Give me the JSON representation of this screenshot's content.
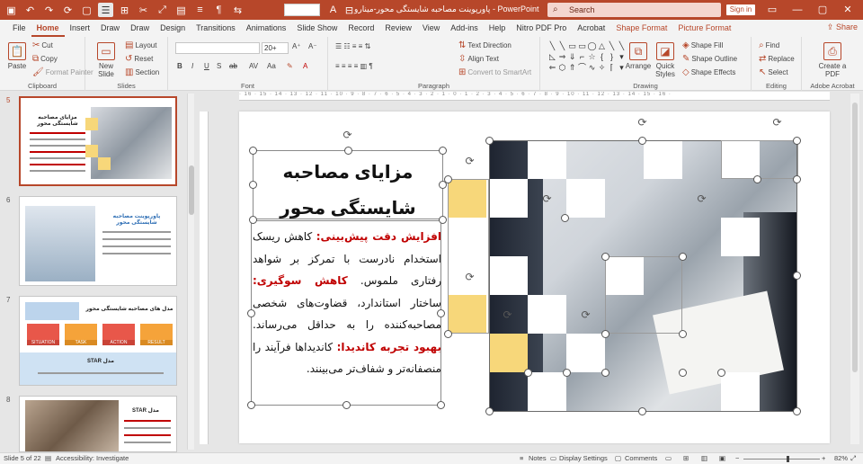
{
  "window": {
    "title": "پاورپوینت مصاحبه شایستگی محور-مینارو  -  PowerPoint",
    "search_placeholder": "Search",
    "sign_in": "Sign in",
    "share": "Share"
  },
  "tabs": [
    "File",
    "Home",
    "Insert",
    "Draw",
    "Draw",
    "Design",
    "Transitions",
    "Animations",
    "Slide Show",
    "Record",
    "Review",
    "View",
    "Add-ins",
    "Help",
    "Nitro PDF Pro",
    "Acrobat",
    "Shape Format",
    "Picture Format"
  ],
  "ribbon": {
    "clipboard": {
      "label": "Clipboard",
      "paste": "Paste",
      "cut": "Cut",
      "copy": "Copy",
      "format_painter": "Format Painter"
    },
    "slides": {
      "label": "Slides",
      "new_slide": "New Slide",
      "layout": "Layout",
      "reset": "Reset",
      "section": "Section"
    },
    "font": {
      "label": "Font",
      "size": "20+"
    },
    "paragraph": {
      "label": "Paragraph",
      "text_direction": "Text Direction",
      "align_text": "Align Text",
      "convert_smartart": "Convert to SmartArt"
    },
    "drawing": {
      "label": "Drawing",
      "arrange": "Arrange",
      "quick_styles": "Quick Styles",
      "shape_fill": "Shape Fill",
      "shape_outline": "Shape Outline",
      "shape_effects": "Shape Effects"
    },
    "editing": {
      "label": "Editing",
      "find": "Find",
      "replace": "Replace",
      "select": "Select"
    },
    "adobe": {
      "label": "Adobe Acrobat",
      "create_pdf": "Create a PDF"
    }
  },
  "thumbnails": [
    {
      "num": "5",
      "title": "مزایای مصاحبه شایستگی محور"
    },
    {
      "num": "6",
      "title": "پاورپوینت مصاحبه شایستگی محور"
    },
    {
      "num": "7",
      "title": "مدل های مصاحبه شایستگی محور",
      "labels": [
        "SITUATION",
        "TASK",
        "ACTION",
        "RESULT"
      ],
      "model": "مدل STAR"
    },
    {
      "num": "8",
      "title": "مدل STAR"
    }
  ],
  "slide": {
    "title": "مزایای مصاحبه شایستگی محور",
    "points": [
      {
        "head": "افزایش دقت پیش‌بینی:",
        "text": " کاهش ریسک استخدام نادرست با تمرکز بر شواهد رفتاری ملموس."
      },
      {
        "head": "کاهش سوگیری:",
        "text": " ساختار استاندارد، قضاوت‌های شخصی مصاحبه‌کننده را به حداقل می‌رساند."
      },
      {
        "head": "بهبود تجربه کاندیدا:",
        "text": " کاندیداها فرآیند را منصفانه‌تر و شفاف‌تر می‌بینند."
      }
    ]
  },
  "status": {
    "slide_of": "Slide 5 of 22",
    "accessibility": "Accessibility: Investigate",
    "notes": "Notes",
    "display_settings": "Display Settings",
    "comments": "Comments",
    "zoom": "82%"
  }
}
